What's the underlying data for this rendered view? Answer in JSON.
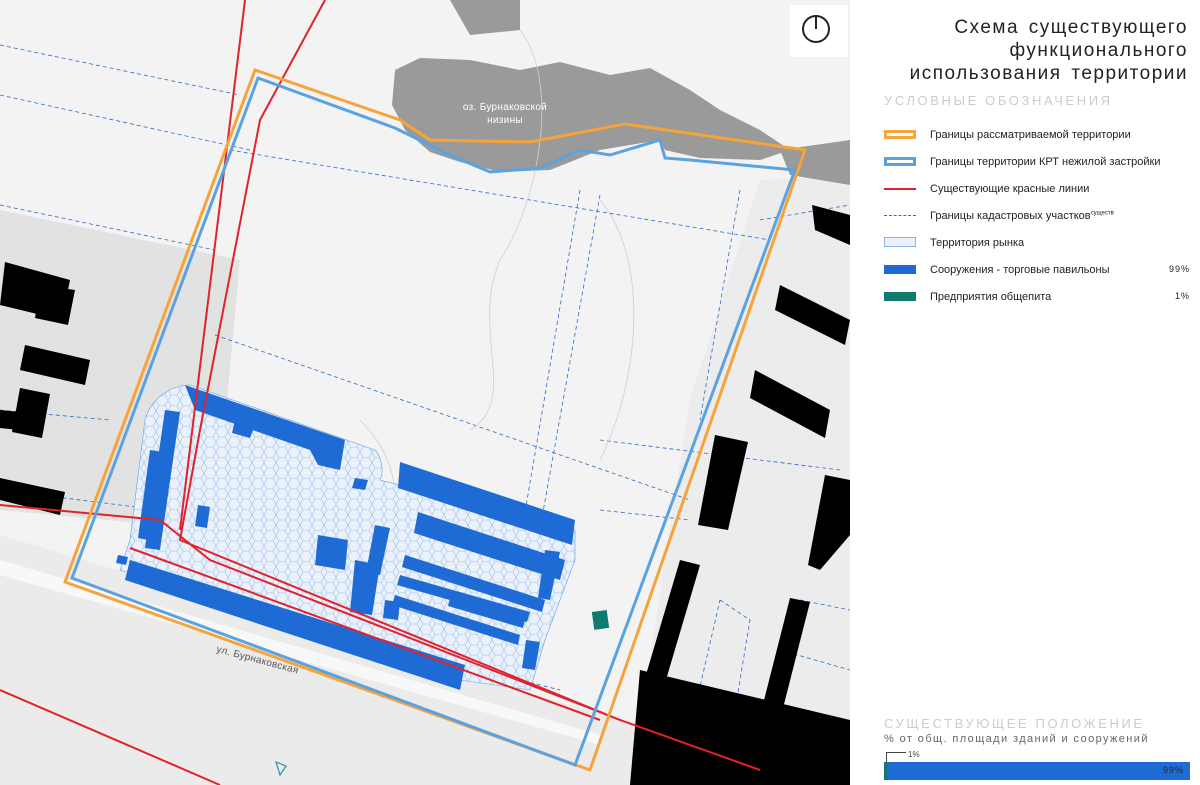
{
  "title": {
    "lines": [
      "Схема существующего",
      "функционального",
      "использования   территории"
    ]
  },
  "legend": {
    "heading": "УСЛОВНЫЕ ОБОЗНАЧЕНИЯ",
    "items": [
      {
        "key": "study-boundary",
        "label": "Границы рассматриваемой территории",
        "color": "#f5a33a"
      },
      {
        "key": "krt-boundary",
        "label": "Границы территории КРТ нежилой застройки",
        "color": "#5aa3e0"
      },
      {
        "key": "red-lines",
        "label": "Существующие красные линии",
        "color": "#e0232b"
      },
      {
        "key": "cadastral",
        "label": "Границы кадастровых участков",
        "sup": "существ",
        "color": "#2b6cc4"
      },
      {
        "key": "market",
        "label": "Территория рынка",
        "color": "#8bb6e8"
      },
      {
        "key": "pavilions",
        "label": "Сооружения    - торговые павильоны",
        "percent": "99%",
        "color": "#1f6bd6"
      },
      {
        "key": "food",
        "label": "Предприятия общепита",
        "percent": "1%",
        "color": "#0f7a6e"
      }
    ]
  },
  "map": {
    "lake_label_line1": "оз. Бурнаковской",
    "lake_label_line2": "низины",
    "street_label": "ул. Бурнаковская",
    "compass_icon": "north-arrow-icon"
  },
  "status": {
    "heading": "СУЩЕСТВУЮЩЕЕ ПОЛОЖЕНИЕ",
    "subtitle": "% от общ. площади зданий и сооружений",
    "food_label": "1%",
    "pavilion_label": "99%",
    "food_share": 0.01,
    "pavilion_share": 0.99
  },
  "chart_data": {
    "type": "bar",
    "categories": [
      "Предприятия общепита",
      "Сооружения - торговые павильоны"
    ],
    "values": [
      1,
      99
    ],
    "stacked": true,
    "unit": "%"
  },
  "colors": {
    "orange": "#f5a33a",
    "blue_line": "#5aa3e0",
    "red_line": "#e0232b",
    "pavilion": "#1f6bd6",
    "food": "#0f7a6e",
    "building": "#000000",
    "lake": "#999999"
  }
}
